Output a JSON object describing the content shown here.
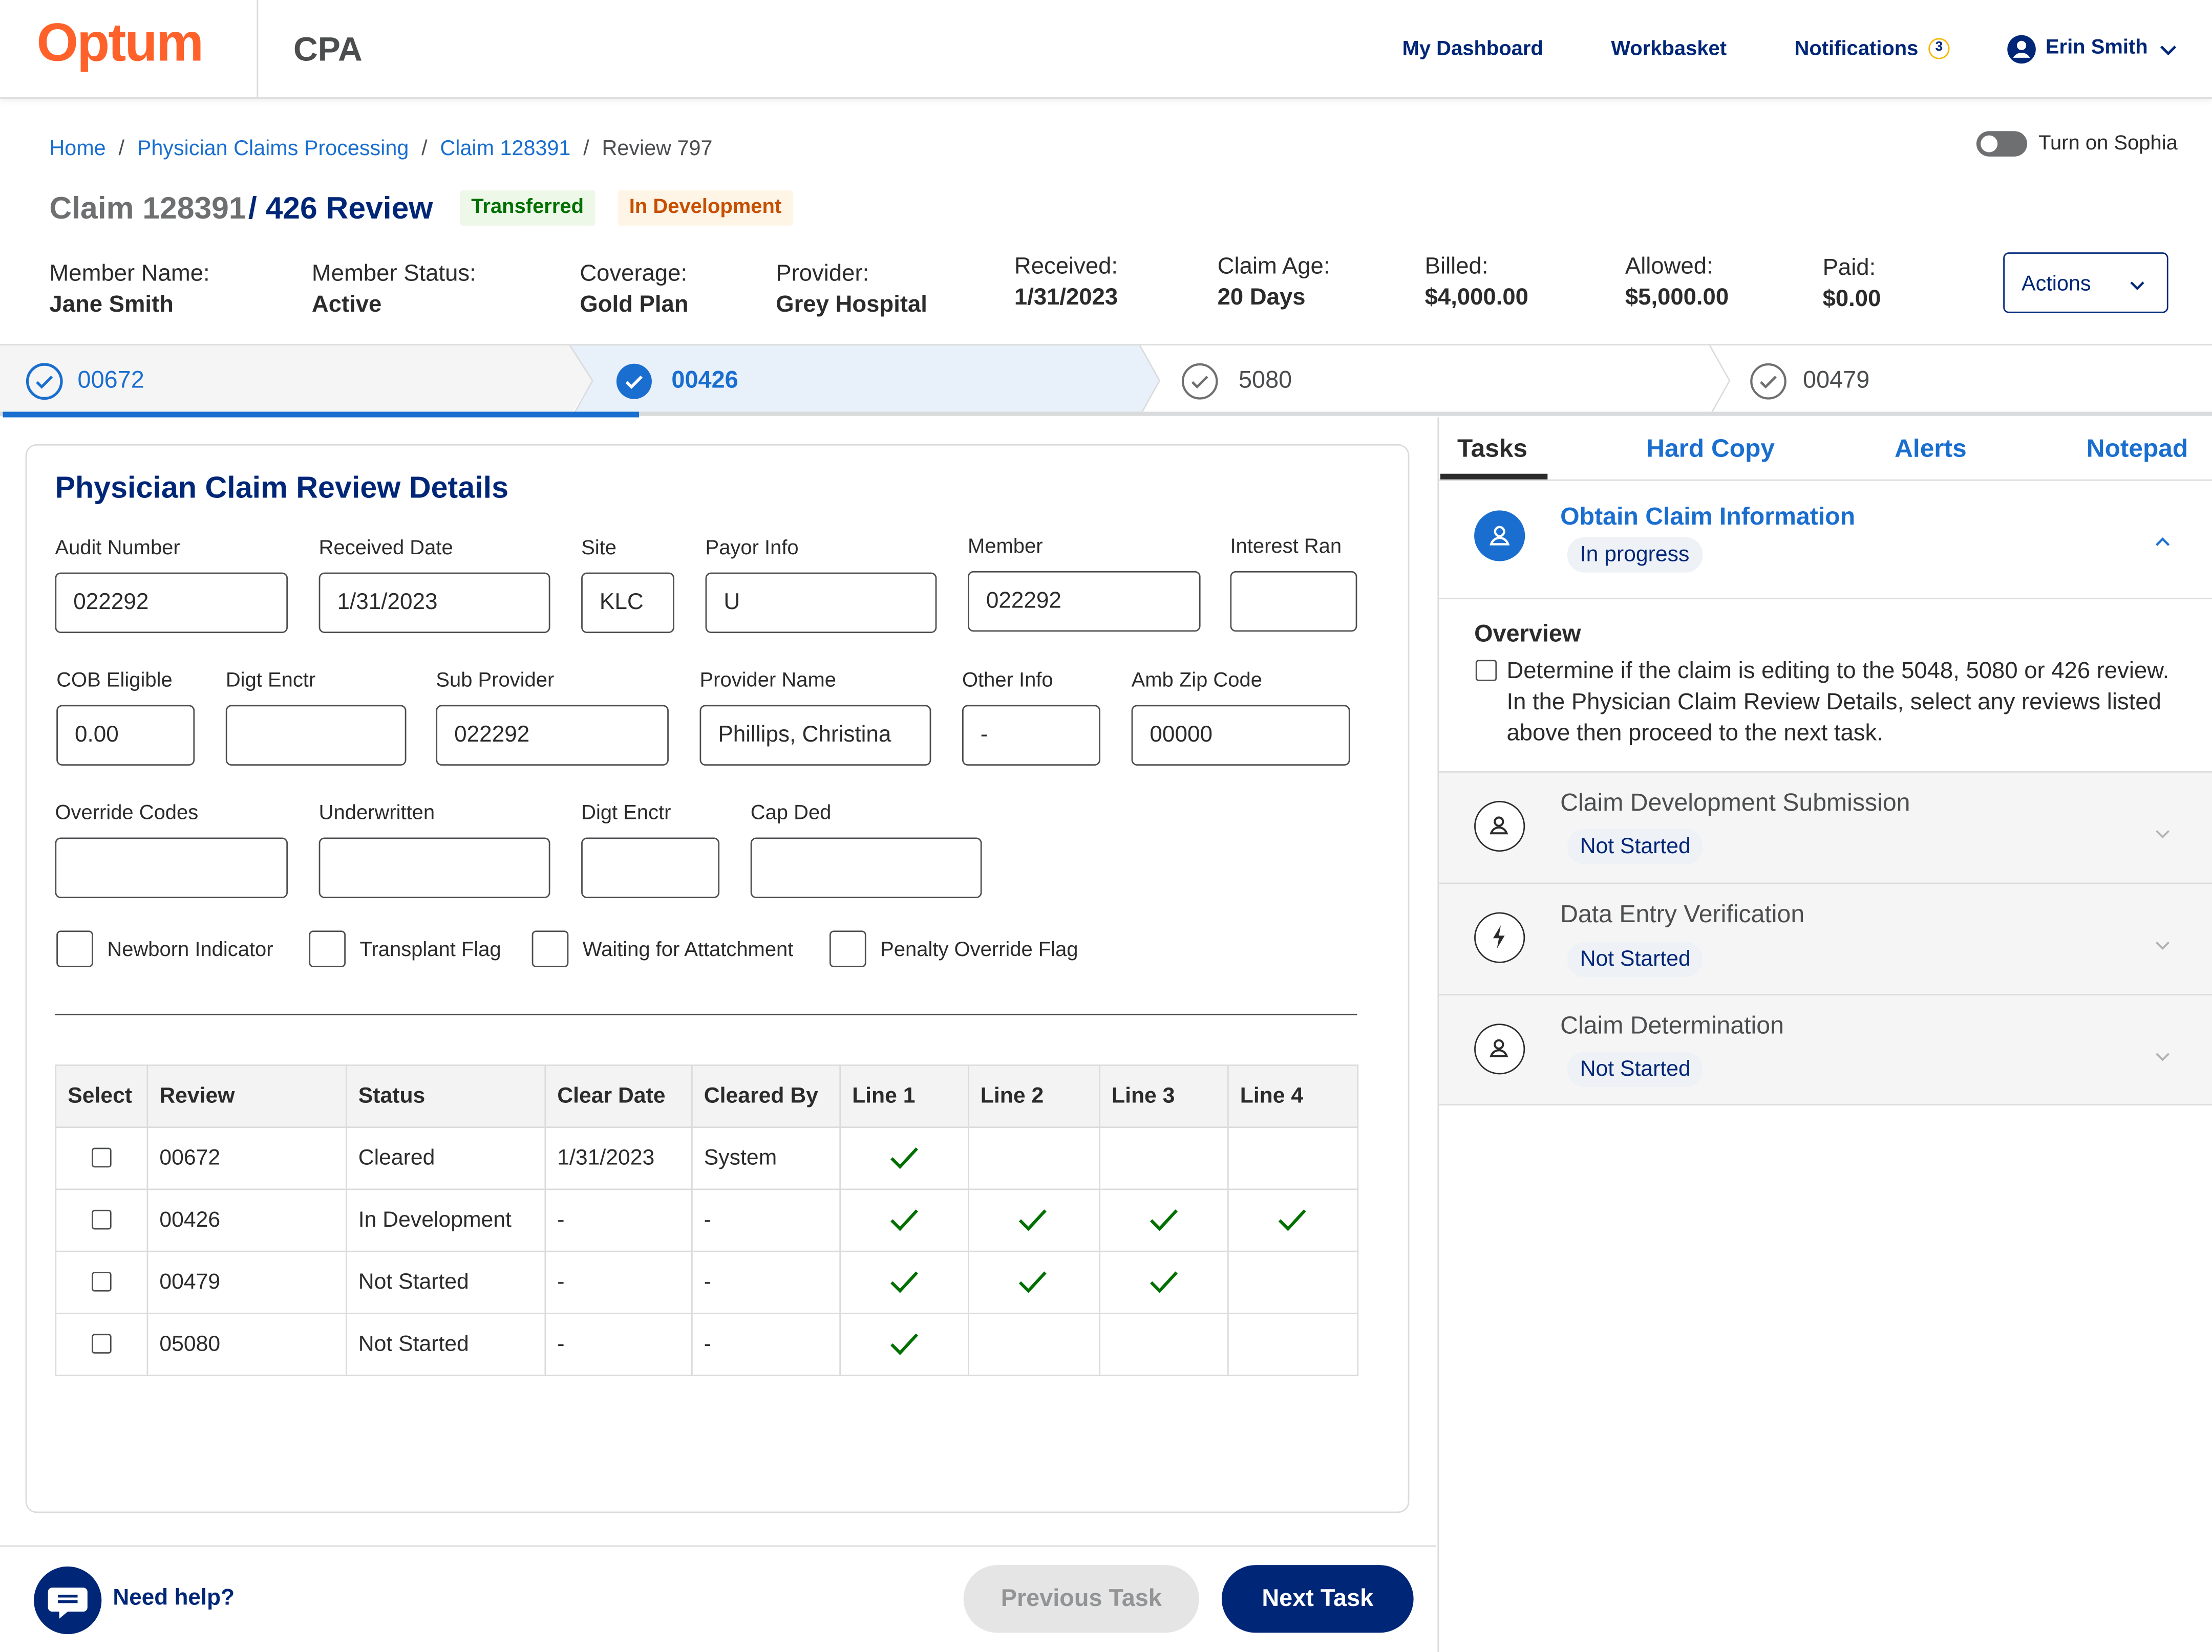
{
  "header": {
    "logo": "Optum",
    "app_name": "CPA",
    "nav": [
      "My Dashboard",
      "Workbasket",
      "Notifications"
    ],
    "notification_count": "3",
    "user_name": "Erin Smith"
  },
  "breadcrumb": [
    "Home",
    "Physician Claims Processing",
    "Claim 128391",
    "Review 797"
  ],
  "sophia_toggle": {
    "label": "Turn on Sophia",
    "on": false
  },
  "title": {
    "claim": "Claim 128391",
    "review": "/ 426 Review",
    "badges": [
      "Transferred",
      "In Development"
    ]
  },
  "info": [
    {
      "label": "Member Name:",
      "value": "Jane Smith"
    },
    {
      "label": "Member Status:",
      "value": "Active"
    },
    {
      "label": "Coverage:",
      "value": "Gold Plan"
    },
    {
      "label": "Provider:",
      "value": "Grey Hospital"
    },
    {
      "label": "Received:",
      "value": "1/31/2023"
    },
    {
      "label": "Claim Age:",
      "value": "20 Days"
    },
    {
      "label": "Billed:",
      "value": "$4,000.00"
    },
    {
      "label": "Allowed:",
      "value": "$5,000.00"
    },
    {
      "label": "Paid:",
      "value": "$0.00"
    }
  ],
  "actions_label": "Actions",
  "steps": [
    {
      "label": "00672",
      "state": "completed"
    },
    {
      "label": "00426",
      "state": "active"
    },
    {
      "label": "5080",
      "state": "pending"
    },
    {
      "label": "00479",
      "state": "pending"
    }
  ],
  "card": {
    "title": "Physician Claim Review Details",
    "fields": [
      {
        "label": "Audit Number",
        "value": "022292"
      },
      {
        "label": "Received Date",
        "value": "1/31/2023"
      },
      {
        "label": "Site",
        "value": "KLC"
      },
      {
        "label": "Payor Info",
        "value": "U"
      },
      {
        "label": "Member",
        "value": "022292"
      },
      {
        "label": "Interest Ran",
        "value": ""
      },
      {
        "label": "COB Eligible",
        "value": "0.00"
      },
      {
        "label": "Digt Enctr",
        "value": ""
      },
      {
        "label": "Sub Provider",
        "value": "022292"
      },
      {
        "label": "Provider Name",
        "value": "Phillips, Christina"
      },
      {
        "label": "Other Info",
        "value": "-"
      },
      {
        "label": "Amb Zip Code",
        "value": "00000"
      },
      {
        "label": "Override Codes",
        "value": ""
      },
      {
        "label": "Underwritten",
        "value": ""
      },
      {
        "label": "Digt Enctr",
        "value": ""
      },
      {
        "label": "Cap Ded",
        "value": ""
      }
    ],
    "checkboxes": [
      "Newborn Indicator",
      "Transplant Flag",
      "Waiting for Attatchment",
      "Penalty Override Flag"
    ]
  },
  "table": {
    "headers": [
      "Select",
      "Review",
      "Status",
      "Clear Date",
      "Cleared By",
      "Line 1",
      "Line 2",
      "Line 3",
      "Line 4"
    ],
    "rows": [
      {
        "review": "00672",
        "status": "Cleared",
        "clear_date": "1/31/2023",
        "cleared_by": "System",
        "lines": [
          true,
          false,
          false,
          false
        ]
      },
      {
        "review": "00426",
        "status": "In Development",
        "clear_date": "-",
        "cleared_by": "-",
        "lines": [
          true,
          true,
          true,
          true
        ]
      },
      {
        "review": "00479",
        "status": "Not Started",
        "clear_date": "-",
        "cleared_by": "-",
        "lines": [
          true,
          true,
          true,
          false
        ]
      },
      {
        "review": "05080",
        "status": "Not Started",
        "clear_date": "-",
        "cleared_by": "-",
        "lines": [
          true,
          false,
          false,
          false
        ]
      }
    ]
  },
  "footer": {
    "help": "Need help?",
    "prev": "Previous Task",
    "next": "Next Task"
  },
  "right_panel": {
    "tabs": [
      "Tasks",
      "Hard Copy",
      "Alerts",
      "Notepad"
    ],
    "tasks": [
      {
        "title": "Obtain Claim Information",
        "status": "In progress",
        "icon": "person-icon"
      },
      {
        "title": "Claim Development Submission",
        "status": "Not Started",
        "icon": "person-icon"
      },
      {
        "title": "Data Entry Verification",
        "status": "Not Started",
        "icon": "lightning-icon"
      },
      {
        "title": "Claim Determination",
        "status": "Not Started",
        "icon": "person-icon"
      }
    ],
    "overview_title": "Overview",
    "overview_text": "Determine if the claim is editing to the 5048, 5080 or 426 review.  In the Physician Claim Review Details, select any reviews listed above then proceed to the next task."
  },
  "colors": {
    "brand": "#ff612b",
    "navy": "#002677",
    "link": "#196ecf",
    "success": "#007000"
  }
}
